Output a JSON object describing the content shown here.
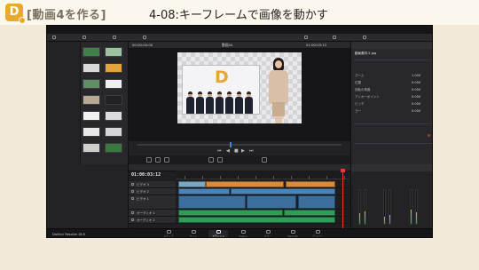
{
  "header": {
    "chapter": "[動画4を作る]",
    "lesson_title": "4-08:キーフレームで画像を動かす"
  },
  "app": {
    "brand": "DaVinci Resolve 18.6",
    "viewer": {
      "clip_name": "動画04",
      "timecode_left": "00:00:00:00",
      "timecode_right": "01:00:03:12"
    },
    "timeline": {
      "timecode": "01:00:03:12",
      "tracks": [
        {
          "label": "ビデオ 3"
        },
        {
          "label": "ビデオ 2"
        },
        {
          "label": "ビデオ 1"
        },
        {
          "label": "オーディオ 1"
        },
        {
          "label": "オーディオ 2"
        }
      ]
    },
    "inspector": {
      "title": "インスペクタ",
      "file": "動画素材-5.jpg",
      "rows": [
        {
          "label": "ズーム",
          "value": "1.000"
        },
        {
          "label": "位置",
          "value": "0.000"
        },
        {
          "label": "回転の角度",
          "value": "0.000"
        },
        {
          "label": "アンカーポイント",
          "value": "0.000"
        },
        {
          "label": "ピッチ",
          "value": "0.000"
        },
        {
          "label": "ヨー",
          "value": "0.000"
        }
      ]
    },
    "pages": [
      {
        "label": "メディア"
      },
      {
        "label": "カット"
      },
      {
        "label": "エディット",
        "active": true
      },
      {
        "label": "Fusion"
      },
      {
        "label": "カラー"
      },
      {
        "label": "Fairlight"
      },
      {
        "label": "デリバー"
      }
    ]
  }
}
